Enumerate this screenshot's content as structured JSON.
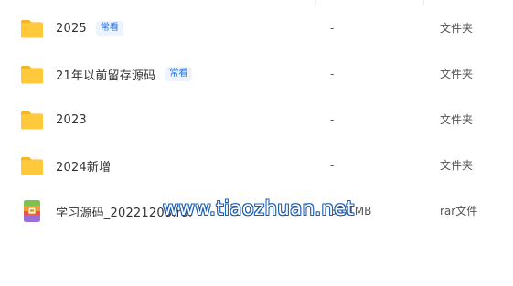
{
  "files": [
    {
      "name": "2025",
      "badge": "常看",
      "size": "-",
      "type": "文件夹",
      "icon": "folder-icon"
    },
    {
      "name": "21年以前留存源码",
      "badge": "常看",
      "size": "-",
      "type": "文件夹",
      "icon": "folder-icon"
    },
    {
      "name": "2023",
      "badge": "",
      "size": "-",
      "type": "文件夹",
      "icon": "folder-icon"
    },
    {
      "name": "2024新增",
      "badge": "",
      "size": "-",
      "type": "文件夹",
      "icon": "folder-icon"
    },
    {
      "name": "学习源码_20221203.rar",
      "badge": "",
      "size": "3.61MB",
      "type": "rar文件",
      "icon": "rar-archive-icon"
    }
  ],
  "watermark": "www.tiaozhuan.net",
  "colors": {
    "folder": "#ffc93b",
    "badge_text": "#1a73e8",
    "badge_bg": "#eef4ff",
    "watermark_outline": "#1a5db5"
  }
}
